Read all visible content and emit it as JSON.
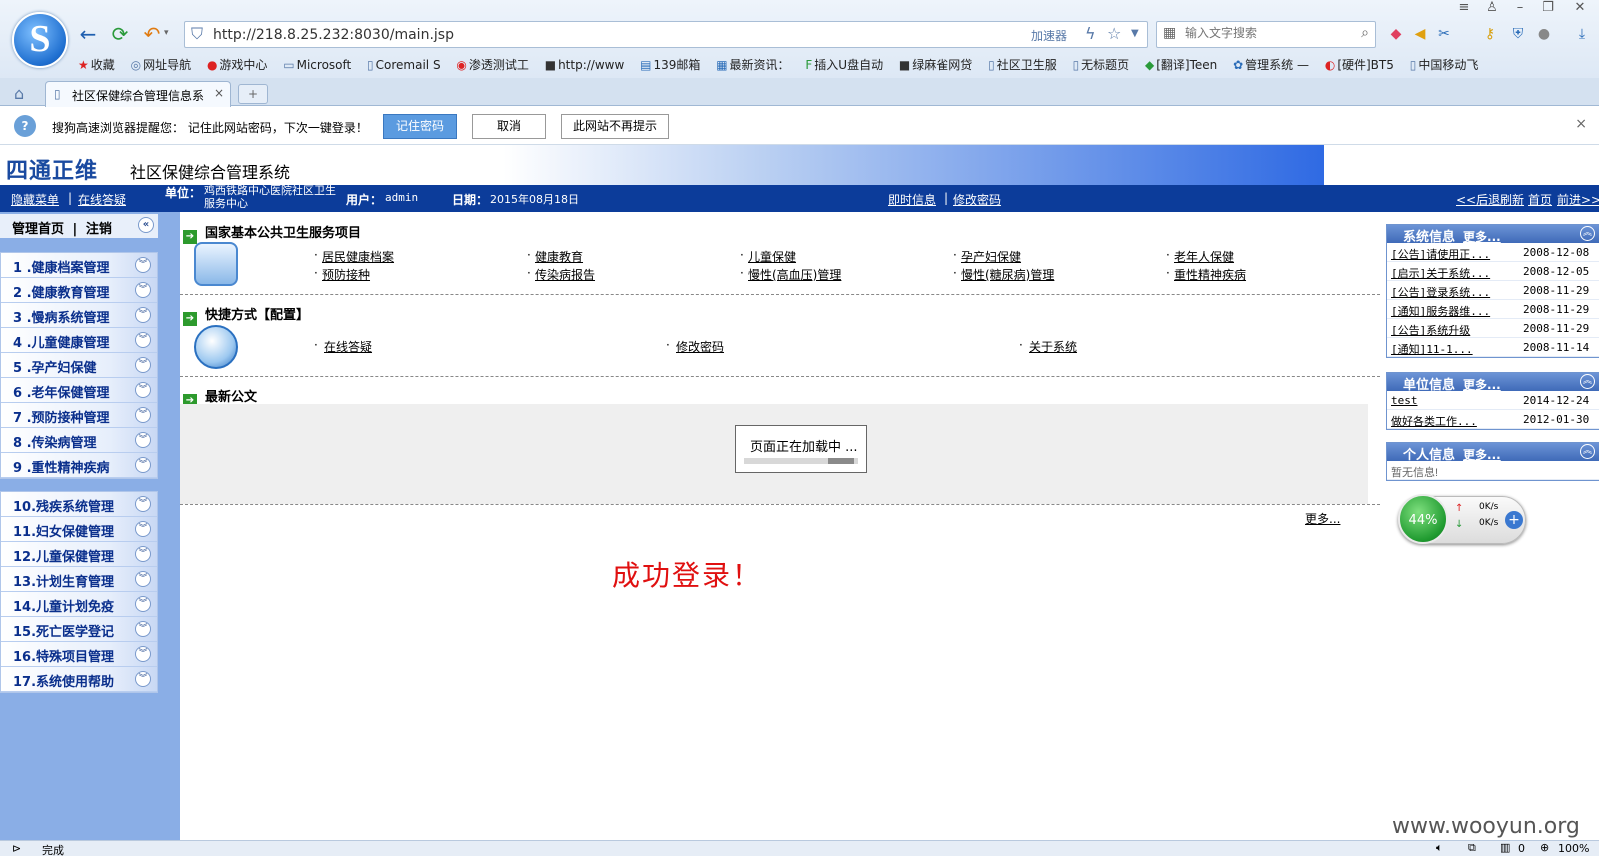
{
  "browser": {
    "url": "http://218.8.25.232:8030/main.jsp",
    "accelerator": "加速器",
    "search_placeholder": "输入文字搜索",
    "bookmarks": [
      "收藏",
      "网址导航",
      "游戏中心",
      "Microsoft",
      "Coremail S",
      "渗透测试工",
      "http://www",
      "139邮箱",
      "最新资讯：",
      "插入U盘自动",
      "绿麻雀网贷",
      "社区卫生服",
      "无标题页",
      "[翻译]Teen",
      "管理系统 —",
      "[硬件]BT5",
      "中国移动飞"
    ],
    "tab_title": "社区保健综合管理信息系",
    "tab_add": "+",
    "tab_close": "×",
    "password_prompt": "搜狗高速浏览器提醒您：  记住此网站密码，下次一键登录！",
    "btn_remember": "记住密码",
    "btn_cancel": "取消",
    "btn_never": "此网站不再提示",
    "close": "×",
    "status": "完成",
    "zoom": "100%",
    "counter": "0"
  },
  "banner": {
    "brand": "四通正维",
    "system_name": "社区保健综合管理系统"
  },
  "topbar": {
    "hide_menu": "隐藏菜单",
    "online_qa": "在线答疑",
    "unit_label": "单位：",
    "unit_value": "鸡西铁路中心医院社区卫生服务中心",
    "user_label": "用户：",
    "user_value": "admin",
    "date_label": "日期：",
    "date_value": "2015年08月18日",
    "instant_info": "即时信息",
    "change_pwd": "修改密码",
    "back": "<<后退",
    "refresh": "刷新",
    "home": "首页",
    "forward": "前进>>"
  },
  "sidebar": {
    "home": "管理首页",
    "logout": "注销",
    "group1": [
      "1 .健康档案管理",
      "2 .健康教育管理",
      "3 .慢病系统管理",
      "4 .儿童健康管理",
      "5 .孕产妇保健",
      "6 .老年保健管理",
      "7 .预防接种管理",
      "8 .传染病管理",
      "9 .重性精神疾病"
    ],
    "group2": [
      "10.残疾系统管理",
      "11.妇女保健管理",
      "12.儿童保健管理",
      "13.计划生育管理",
      "14.儿童计划免疫",
      "15.死亡医学登记",
      "16.特殊项目管理",
      "17.系统使用帮助"
    ]
  },
  "main": {
    "section1_title": "国家基本公共卫生服务项目",
    "services": [
      "居民健康档案",
      "健康教育",
      "儿童保健",
      "孕产妇保健",
      "老年人保健",
      "预防接种",
      "传染病报告",
      "慢性(高血压)管理",
      "慢性(糖尿病)管理",
      "重性精神疾病"
    ],
    "section2_title": "快捷方式【配置】",
    "shortcuts": [
      "在线答疑",
      "修改密码",
      "关于系统"
    ],
    "section3_title": "最新公文",
    "loading": "页面正在加载中 ...",
    "more": "更多...",
    "success": "成功登录！"
  },
  "panels": {
    "more": "更多...",
    "system_title": "系统信息",
    "system_items": [
      {
        "title": "[公告]请使用正...",
        "date": "2008-12-08"
      },
      {
        "title": "[启示]关于系统...",
        "date": "2008-12-05"
      },
      {
        "title": "[公告]登录系统...",
        "date": "2008-11-29"
      },
      {
        "title": "[通知]服务器维...",
        "date": "2008-11-29"
      },
      {
        "title": "[公告]系统升级",
        "date": "2008-11-29"
      },
      {
        "title": "[通知]11-1...",
        "date": "2008-11-14"
      }
    ],
    "unit_title": "单位信息",
    "unit_items": [
      {
        "title": "test",
        "date": "2014-12-24"
      },
      {
        "title": "做好各类工作...",
        "date": "2012-01-30"
      }
    ],
    "personal_title": "个人信息",
    "personal_empty": "暂无信息!"
  },
  "net": {
    "percent": "44%",
    "up": "0K/s",
    "down": "0K/s"
  },
  "watermark": "www.wooyun.org"
}
